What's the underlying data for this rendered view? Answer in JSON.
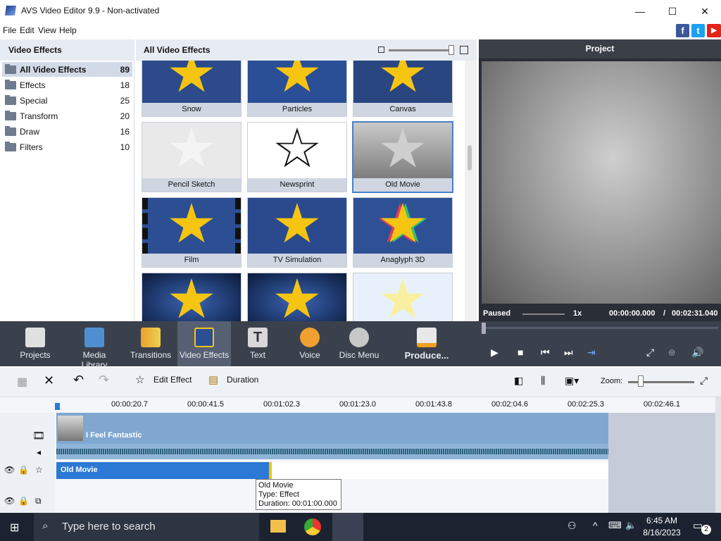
{
  "window": {
    "title": "AVS Video Editor 9.9 - Non-activated",
    "controls": [
      "—",
      "☐",
      "✕"
    ]
  },
  "menu": [
    "File",
    "Edit",
    "View",
    "Help"
  ],
  "social": [
    {
      "letter": "f",
      "color": "#3b5998"
    },
    {
      "letter": "t",
      "color": "#1da1f2"
    },
    {
      "letter": "▶",
      "color": "#e62117"
    }
  ],
  "left_panel": {
    "title": "Video Effects",
    "categories": [
      {
        "name": "All Video Effects",
        "count": "89"
      },
      {
        "name": "Effects",
        "count": "18"
      },
      {
        "name": "Special",
        "count": "25"
      },
      {
        "name": "Transform",
        "count": "20"
      },
      {
        "name": "Draw",
        "count": "16"
      },
      {
        "name": "Filters",
        "count": "10"
      }
    ]
  },
  "effects_panel": {
    "title": "All Video Effects",
    "tiles": [
      {
        "label": "Snow",
        "bg": "#2d4b8a"
      },
      {
        "label": "Particles",
        "bg": "#2b4f96"
      },
      {
        "label": "Canvas",
        "bg": "#2a4680"
      },
      {
        "label": "Pencil Sketch",
        "bg": "#e9e9e9"
      },
      {
        "label": "Newsprint",
        "bg": "#ffffff"
      },
      {
        "label": "Old Movie",
        "bg": "#9a9a9a"
      },
      {
        "label": "Film",
        "bg": "#2c4e93"
      },
      {
        "label": "TV Simulation",
        "bg": "#2b4a8e"
      },
      {
        "label": "Anaglyph 3D",
        "bg": "#2e5095"
      },
      {
        "label": "",
        "bg": "#243f78"
      },
      {
        "label": "",
        "bg": "#243f78"
      },
      {
        "label": "",
        "bg": "#e8f1fb"
      }
    ]
  },
  "preview": {
    "title": "Project",
    "status": "Paused",
    "speed": "1x",
    "time_current": "00:00:00.000",
    "time_sep": "/",
    "time_total": "00:02:31.040"
  },
  "main_toolbar": [
    "Projects",
    "Media Library",
    "Transitions",
    "Video Effects",
    "Text",
    "Voice",
    "Disc Menu",
    "Produce..."
  ],
  "timeline_toolbar": {
    "edit_effect": "Edit Effect",
    "duration": "Duration",
    "zoom": "Zoom:"
  },
  "ruler": [
    "00:00:20.7",
    "00:00:41.5",
    "00:01:02.3",
    "00:01:23.0",
    "00:01:43.8",
    "00:02:04.6",
    "00:02:25.3",
    "00:02:46.1"
  ],
  "tracks": {
    "video_clip": "I Feel Fantastic",
    "effect_clip": "Old Movie"
  },
  "tooltip": {
    "line1": "Old Movie",
    "line2": "Type: Effect",
    "line3": "Duration: 00:01:00.000"
  },
  "taskbar": {
    "search_placeholder": "Type here to search",
    "time": "6:45 AM",
    "date": "8/16/2023",
    "notifications": "2"
  }
}
